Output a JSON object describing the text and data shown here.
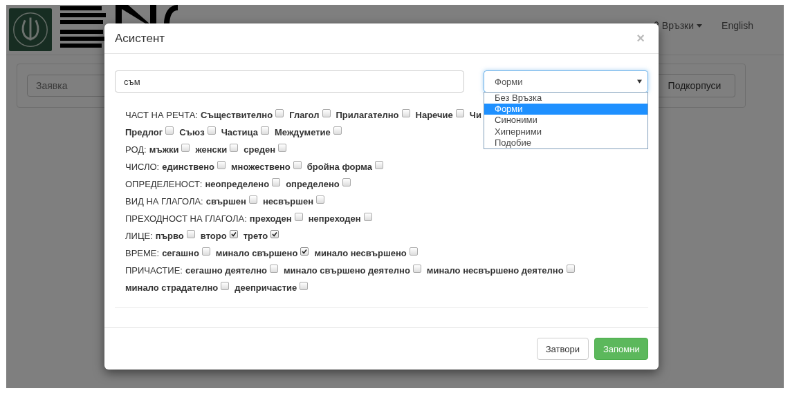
{
  "navbar": {
    "links": [
      {
        "label": "Връзки",
        "kind": "dropdown"
      },
      {
        "label": "English",
        "kind": "plain"
      }
    ]
  },
  "search_panel": {
    "query_placeholder": "Заявка",
    "subcorpora_button": "Подкорпуси"
  },
  "dialog": {
    "title": "Асистент",
    "close": "×",
    "query": {
      "value": "съм"
    },
    "relation_select": {
      "value": "Форми",
      "expanded": true,
      "options": [
        {
          "label": "Без Връзка",
          "selected": false
        },
        {
          "label": "Форми",
          "selected": true
        },
        {
          "label": "Синоними",
          "selected": false
        },
        {
          "label": "Хиперними",
          "selected": false
        },
        {
          "label": "Подобие",
          "selected": false
        }
      ]
    },
    "groups": [
      {
        "label": "ЧАСТ НА РЕЧТА:",
        "items": [
          {
            "label": "Съществително",
            "checked": false
          },
          {
            "label": "Глагол",
            "checked": false
          },
          {
            "label": "Прилагателно",
            "checked": false
          },
          {
            "label": "Наречие",
            "checked": false
          },
          {
            "label": "Чи",
            "kind": "cut"
          },
          {
            "label": "Предлог",
            "checked": false
          },
          {
            "label": "Съюз",
            "checked": false
          },
          {
            "label": "Частица",
            "checked": false
          },
          {
            "label": "Междуметие",
            "checked": false
          }
        ]
      },
      {
        "label": "РОД:",
        "items": [
          {
            "label": "мъжки",
            "checked": false
          },
          {
            "label": "женски",
            "checked": false
          },
          {
            "label": "среден",
            "checked": false
          }
        ]
      },
      {
        "label": "ЧИСЛО:",
        "items": [
          {
            "label": "единствено",
            "checked": false
          },
          {
            "label": "множествено",
            "checked": false
          },
          {
            "label": "бройна форма",
            "checked": false
          }
        ]
      },
      {
        "label": "ОПРЕДЕЛЕНОСТ:",
        "items": [
          {
            "label": "неопределено",
            "checked": false
          },
          {
            "label": "определено",
            "checked": false
          }
        ]
      },
      {
        "label": "ВИД НА ГЛАГОЛА:",
        "items": [
          {
            "label": "свършен",
            "checked": false
          },
          {
            "label": "несвършен",
            "checked": false
          }
        ]
      },
      {
        "label": "ПРЕХОДНОСТ НА ГЛАГОЛА:",
        "items": [
          {
            "label": "преходен",
            "checked": false
          },
          {
            "label": "непреходен",
            "checked": false
          }
        ]
      },
      {
        "label": "ЛИЦЕ:",
        "items": [
          {
            "label": "първо",
            "checked": false
          },
          {
            "label": "второ",
            "checked": true
          },
          {
            "label": "трето",
            "checked": true
          }
        ]
      },
      {
        "label": "ВРЕМЕ:",
        "items": [
          {
            "label": "сегашно",
            "checked": false
          },
          {
            "label": "минало свършено",
            "checked": true
          },
          {
            "label": "минало несвършено",
            "checked": false
          }
        ]
      },
      {
        "label": "ПРИЧАСТИЕ:",
        "items": [
          {
            "label": "сегашно деятелно",
            "checked": false
          },
          {
            "label": "минало свършено деятелно",
            "checked": false
          },
          {
            "label": "минало несвършено деятелно",
            "checked": false
          },
          {
            "label": "минало страдателно",
            "checked": false
          },
          {
            "label": "деепричастие",
            "checked": false
          }
        ]
      }
    ],
    "buttons": [
      {
        "label": "Затвори",
        "kind": "default"
      },
      {
        "label": "Запомни",
        "kind": "primary"
      }
    ]
  }
}
